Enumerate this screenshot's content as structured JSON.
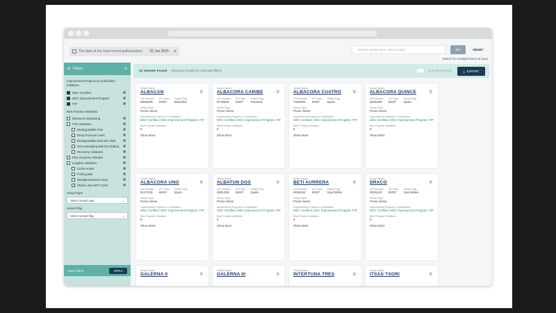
{
  "window": {
    "date_chip": {
      "label": "The date of the most recent authorization:",
      "date": "26 Jun 2025"
    },
    "search": {
      "placeholder": "Search vessel name, IMO number"
    },
    "go_label": "GO",
    "reset_label": "RESET",
    "search_hint": "Search for multiple items at once"
  },
  "sidebar": {
    "title": "Filters",
    "section1": "Improvement Projects & Certification Initiatives",
    "certs": [
      {
        "label": "MSC Certified"
      },
      {
        "label": "MSC Improvement Program"
      },
      {
        "label": "FIP"
      }
    ],
    "section2": "Best Practice Initiatives",
    "practices": [
      {
        "label": "Electronic Monitoring"
      },
      {
        "label": "FAD Initiatives"
      },
      {
        "label": "Biodegradable FAD"
      },
      {
        "label": "Deep Precious Lines"
      },
      {
        "label": "Biodegradable Biomass Tank"
      },
      {
        "label": "Non-entangling with the Netting"
      },
      {
        "label": "Recovery Initiatives"
      },
      {
        "label": "Pets Inventory Initiative"
      },
      {
        "label": "Longline Initiatives"
      },
      {
        "label": "Circle Hooks"
      },
      {
        "label": "Fishing Bait"
      },
      {
        "label": "Weighted Branch Lines"
      },
      {
        "label": "Shark Lines NOT Used"
      }
    ],
    "vessel_type_label": "Vessel Type",
    "vessel_type_value": "Select vessel type",
    "vessel_flag_label": "Vessel Flag",
    "vessel_flag_value": "Select vessel flag",
    "clear_label": "Clear Filters",
    "apply_label": "APPLY"
  },
  "results": {
    "found": "21 Vessels Found",
    "showing": "Showing results for selected filters",
    "toggle_label": "Only show pinned",
    "export_label": "EXPORT"
  },
  "card_labels": {
    "vessel_name": "Vessel Name",
    "uvi": "UVI Number",
    "uvi_type": "UVI Type",
    "flag": "Vessel Flag",
    "type": "Vessel Type",
    "projects": "Improvement Projects & Certification",
    "best": "Best Practice Initiatives",
    "show_more": "Show More"
  },
  "vessels": [
    {
      "name": "ALBACAN",
      "uvi": "8906489",
      "uvi_type": "IMO#",
      "flag": "Mauritius",
      "type": "Purse Seine",
      "projects": "MSC Certified, MSC Improvement Program, FIP",
      "best": "8"
    },
    {
      "name": "ALBACORA CARIBE",
      "uvi": "8719825",
      "uvi_type": "IMO#",
      "flag": "Panama",
      "type": "Purse Seine",
      "projects": "MSC Certified, MSC Improvement Program, FIP",
      "best": "5"
    },
    {
      "name": "ALBACORA CUATRO",
      "uvi": "7325904",
      "uvi_type": "IMO#",
      "flag": "Spain",
      "type": "Purse Seine",
      "projects": "MSC Certified, MSC Improvement Program, FIP",
      "best": "6"
    },
    {
      "name": "ALBACORA QUINCE",
      "uvi": "8206296",
      "uvi_type": "IMO#",
      "flag": "Spain",
      "type": "Purse Seine",
      "projects": "MSC Certified, MSC Improvement Program, FIP",
      "best": "5"
    },
    {
      "name": "ALBACORA UNO",
      "uvi": "9127425",
      "uvi_type": "IMO#",
      "flag": "Spain",
      "type": "Purse Seine",
      "projects": "MSC Certified, MSC Improvement Program, FIP",
      "best": "6"
    },
    {
      "name": "ALBATUN DOS",
      "uvi": "8081308",
      "uvi_type": "IMO#",
      "flag": "Spain",
      "type": "Purse Seine",
      "projects": "MSC Certified, MSC Improvement Program, FIP",
      "best": "5"
    },
    {
      "name": "BETI AURRERA",
      "uvi": "8228162",
      "uvi_type": "IMO#",
      "flag": "Seychelles",
      "type": "Purse Seine",
      "projects": "MSC Certified, MSC Improvement Program, FIP",
      "best": "6"
    },
    {
      "name": "DRACO",
      "uvi": "9335226",
      "uvi_type": "IMO#",
      "flag": "Seychelles",
      "type": "Purse Seine",
      "projects": "MSC Certified, MSC Improvement Program, FIP",
      "best": "6"
    },
    {
      "name": "GALERNA II",
      "uvi": "",
      "uvi_type": "",
      "flag": "",
      "type": "",
      "projects": "",
      "best": ""
    },
    {
      "name": "GALERNA III",
      "uvi": "",
      "uvi_type": "",
      "flag": "",
      "type": "",
      "projects": "",
      "best": ""
    },
    {
      "name": "INTERTUNA TRES",
      "uvi": "",
      "uvi_type": "",
      "flag": "",
      "type": "",
      "projects": "",
      "best": ""
    },
    {
      "name": "ITSAS TXORI",
      "uvi": "",
      "uvi_type": "",
      "flag": "",
      "type": "",
      "projects": "",
      "best": ""
    }
  ]
}
